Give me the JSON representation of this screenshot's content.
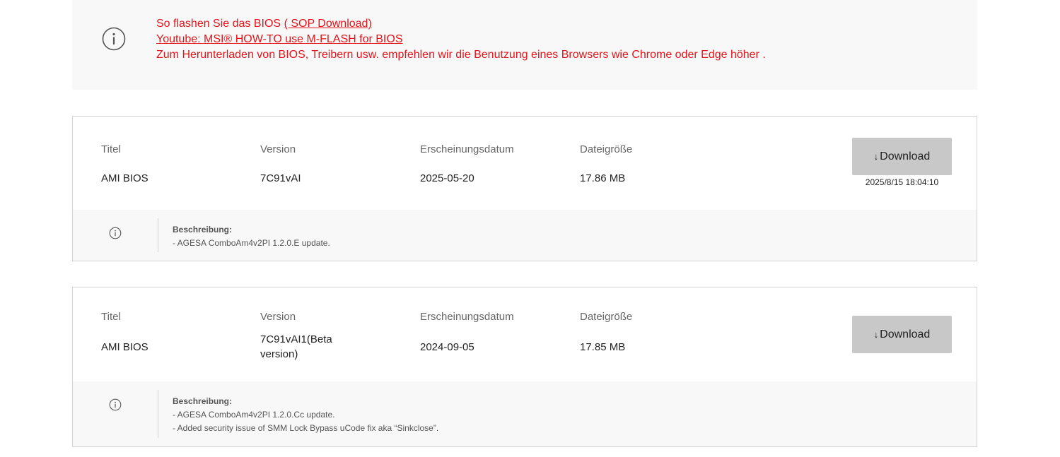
{
  "notice": {
    "line1_prefix": "So flashen Sie das BIOS",
    "line1_link": "( SOP Download)",
    "line2_link": "Youtube: MSI® HOW-TO use M-FLASH for BIOS",
    "line3": "Zum Herunterladen von BIOS, Treibern usw. empfehlen wir die Benutzung eines Browsers wie Chrome oder Edge höher .",
    "icon": "info-icon",
    "color": "#e4151a"
  },
  "columns": {
    "title": "Titel",
    "version": "Version",
    "date": "Erscheinungsdatum",
    "size": "Dateigröße"
  },
  "download_label": "Download",
  "description_label": "Beschreibung:",
  "entries": [
    {
      "title": "AMI BIOS",
      "version": "7C91vAI",
      "date": "2025-05-20",
      "size": "17.86 MB",
      "timestamp": "2025/8/15 18:04:10",
      "description": [
        "- AGESA ComboAm4v2PI 1.2.0.E update."
      ]
    },
    {
      "title": "AMI BIOS",
      "version_line1": "7C91vAI1(Beta",
      "version_line2": "version)",
      "date": "2024-09-05",
      "size": "17.85 MB",
      "description": [
        "- AGESA ComboAm4v2PI 1.2.0.Cc update.",
        "- Added security issue of SMM Lock Bypass uCode fix aka “Sinkclose”."
      ]
    }
  ],
  "colors": {
    "button_bg": "#c8c8c8",
    "panel_bg": "#f8f8f8",
    "border": "#d2d2d2"
  }
}
